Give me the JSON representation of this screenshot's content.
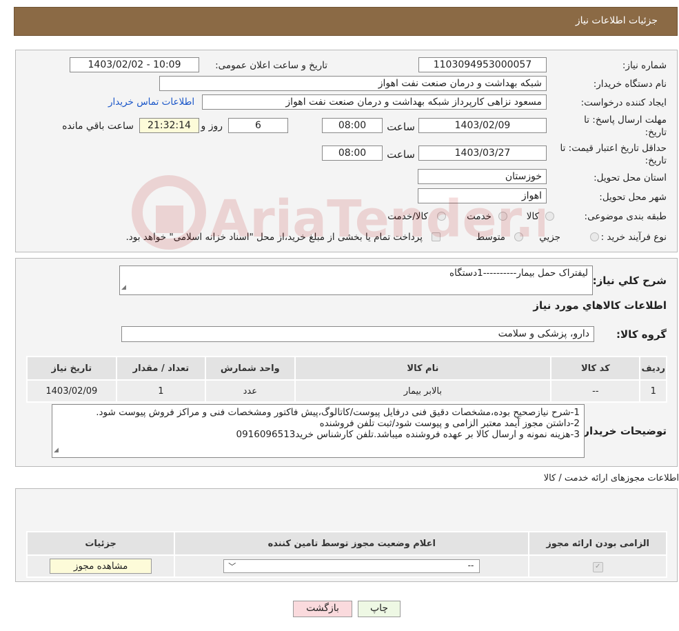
{
  "header": {
    "title": "جزئیات اطلاعات نیاز"
  },
  "form": {
    "need_number_label": "شماره نیاز:",
    "need_number": "1103094953000057",
    "announce_label": "تاریخ و ساعت اعلان عمومی:",
    "announce_value": "1403/02/02 - 10:09",
    "buyer_label": "نام دستگاه خریدار:",
    "buyer_value": "شبکه بهداشت و درمان صنعت نفت اهواز",
    "creator_label": "ایجاد کننده درخواست:",
    "creator_value": "مسعود نزاهی کارپرداز شبکه بهداشت و درمان صنعت نفت اهواز",
    "contact_link": "اطلاعات تماس خریدار",
    "deadline_label": "مهلت ارسال پاسخ: تا تاریخ:",
    "deadline_date": "1403/02/09",
    "time_label": "ساعت",
    "deadline_time": "08:00",
    "days_value": "6",
    "days_label": "روز و",
    "remaining_time": "21:32:14",
    "remaining_label": "ساعت باقي مانده",
    "validity_label": "حداقل تاريخ اعتبار قيمت: تا تاریخ:",
    "validity_date": "1403/03/27",
    "validity_time": "08:00",
    "province_label": "استان محل تحویل:",
    "province_value": "خوزستان",
    "city_label": "شهر محل تحویل:",
    "city_value": "اهواز",
    "category_label": "طبقه بندی موضوعی:",
    "category_options": [
      "کالا",
      "خدمت",
      "کالا/خدمت"
    ],
    "purchase_label": "نوع فرآیند خرید :",
    "purchase_options": [
      "جزیي",
      "متوسط"
    ],
    "purchase_note": "پرداخت تمام یا بخشی از مبلغ خرید،از محل \"اسناد خزانه اسلامی\" خواهد بود."
  },
  "details": {
    "summary_label": "شرح كلي نياز:",
    "summary_value": "لیفتراک حمل بیمار----------1دستگاه",
    "goods_info_title": "اطلاعات کالاهاي مورد نياز",
    "group_label": "گروه کالا:",
    "group_value": "دارو، پزشکی و سلامت",
    "table_headers": [
      "رديف",
      "کد کالا",
      "نام کالا",
      "واحد شمارش",
      "تعداد / مقدار",
      "تاریخ نیاز"
    ],
    "table_rows": [
      [
        "1",
        "--",
        "بالابر بیمار",
        "عدد",
        "1",
        "1403/02/09"
      ]
    ],
    "buyer_notes_label": "توضیحات خریدار:",
    "buyer_notes_lines": [
      "1-شرح نیازصحیح بوده،مشخصات دقیق فنی درفایل پیوست/کاتالوگ،پیش فاکتور ومشخصات فنی و مراکز فروش پیوست شود.",
      "2-داشتن مجوز آیمد معتبر الزامی و پیوست شود/ثبت تلفن فروشنده",
      "3-هزینه  نمونه و ارسال کالا بر عهده فروشنده میباشد.تلفن کارشناس خرید09160965​13"
    ]
  },
  "permits": {
    "section_title": "اطلاعات مجوزهای ارائه خدمت / کالا",
    "headers": [
      "الزامی بودن ارائه مجوز",
      "اعلام وضعیت مجوز توسط تامین کننده",
      "جزئیات"
    ],
    "select_value": "--",
    "view_button": "مشاهده مجوز"
  },
  "footer": {
    "print_button": "چاپ",
    "back_button": "بازگشت"
  },
  "watermark": {
    "text": "AriaTender.neT"
  },
  "colors": {
    "header_bg": "#8b6a45",
    "link": "#1a56c8",
    "back_button": "#fadadd",
    "print_button": "#eef8e4"
  }
}
